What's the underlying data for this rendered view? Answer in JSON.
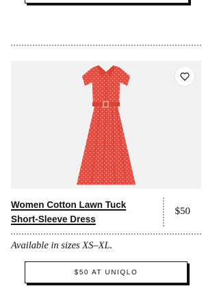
{
  "product": {
    "title": "Women Cotton Lawn Tuck Short-Sleeve Dress",
    "price": "$50",
    "availability": "Available in sizes XS–XL.",
    "buy_label": "$50 AT UNIQLO"
  },
  "icons": {
    "favorite": "heart-icon"
  },
  "colors": {
    "dress": "#e64b3f",
    "image_bg": "#f1f1f1",
    "divider": "#9a9a9a"
  }
}
